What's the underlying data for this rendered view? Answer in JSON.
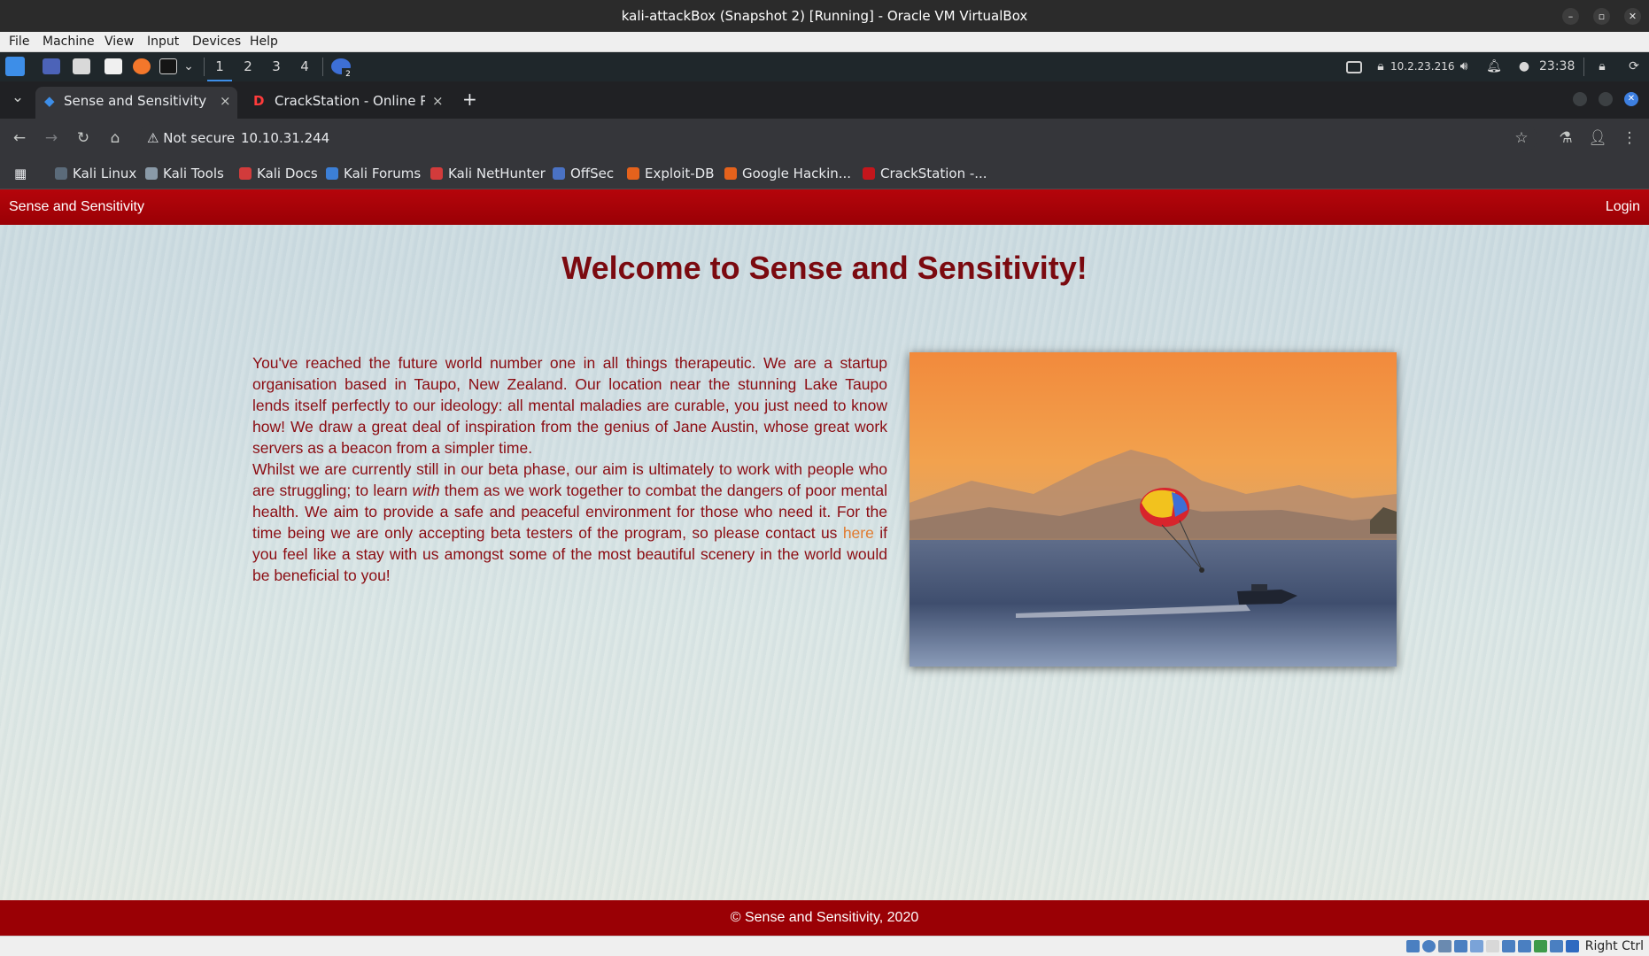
{
  "window": {
    "title": "kali-attackBox (Snapshot 2) [Running] - Oracle VM VirtualBox",
    "controls": [
      "–",
      "▫",
      "✕"
    ]
  },
  "vbox_menu": [
    "File",
    "Machine",
    "View",
    "Input",
    "Devices",
    "Help"
  ],
  "kali_panel": {
    "workspaces": [
      "1",
      "2",
      "3",
      "4"
    ],
    "active_workspace": "1",
    "ip": "10.2.23.216",
    "time": "23:38",
    "badge_count": "2"
  },
  "browser": {
    "tabs": [
      {
        "label": "Sense and Sensitivity",
        "close": "×"
      },
      {
        "label": "CrackStation - Online Pas",
        "close": "×"
      }
    ],
    "new_tab": "+",
    "security_label": "Not secure",
    "url": "10.10.31.244",
    "bookmarks": [
      {
        "label": "Kali Linux",
        "color": "#5b6b7a"
      },
      {
        "label": "Kali Tools",
        "color": "#8a9aa8"
      },
      {
        "label": "Kali Docs",
        "color": "#d23b3b"
      },
      {
        "label": "Kali Forums",
        "color": "#3c7fd6"
      },
      {
        "label": "Kali NetHunter",
        "color": "#d23b3b"
      },
      {
        "label": "OffSec",
        "color": "#4a72c4"
      },
      {
        "label": "Exploit-DB",
        "color": "#e5621c"
      },
      {
        "label": "Google Hackin...",
        "color": "#e5621c"
      },
      {
        "label": "CrackStation -...",
        "color": "#c4161c"
      }
    ]
  },
  "site": {
    "brand": "Sense and Sensitivity",
    "login": "Login",
    "heading": "Welcome to Sense and Sensitivity!",
    "para1": "You've reached the future world number one in all things therapeutic. We are a startup organisation based in Taupo, New Zealand. Our location near the stunning Lake Taupo lends itself perfectly to our ideology: all mental maladies are curable, you just need to know how! We draw a great deal of inspiration from the genius of Jane Austin, whose great work servers as a beacon from a simpler time.",
    "para2_a": "Whilst we are currently still in our beta phase, our aim is ultimately to work with people who are struggling; to learn ",
    "para2_em": "with",
    "para2_b": " them as we work together to combat the dangers of poor mental health. We aim to provide a safe and peaceful environment for those who need it. For the time being we are only accepting beta testers of the program, so please contact us ",
    "para2_link": "here",
    "para2_c": " if you feel like a stay with us amongst some of the most beautiful scenery in the world would be beneficial to you!",
    "footer": "© Sense and Sensitivity, 2020",
    "colors": {
      "nav": "#9a0005",
      "text": "#8b0c12",
      "link": "#e07a2e"
    }
  },
  "status_bar": {
    "host_key": "Right Ctrl"
  }
}
